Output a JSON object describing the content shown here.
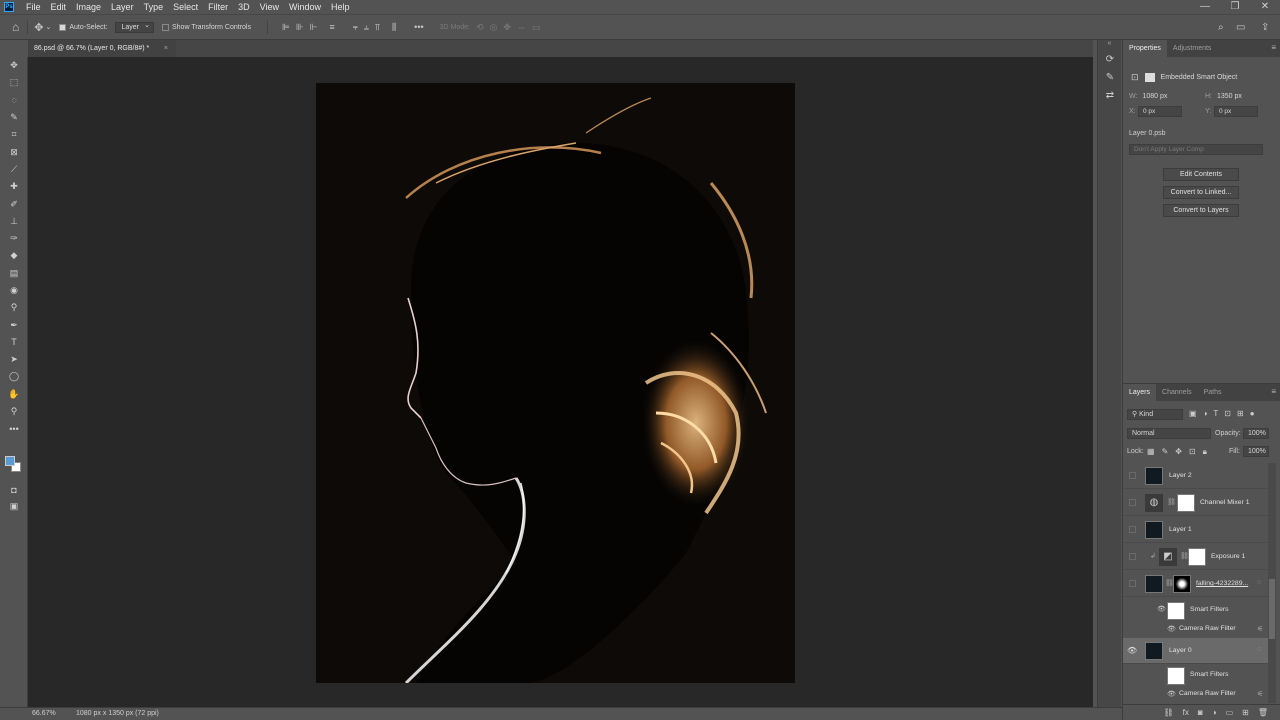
{
  "menu": {
    "logo": "Ps",
    "items": [
      "File",
      "Edit",
      "Image",
      "Layer",
      "Type",
      "Select",
      "Filter",
      "3D",
      "View",
      "Window",
      "Help"
    ],
    "controls": {
      "minimize": "—",
      "restore": "❐",
      "close": "✕"
    }
  },
  "options_bar": {
    "auto_select_label": "Auto-Select:",
    "auto_select_checked": true,
    "target_value": "Layer",
    "show_transform_label": "Show Transform Controls",
    "show_transform_checked": false,
    "mode_3d_label": "3D Mode:"
  },
  "document": {
    "tab_title": "86.psd @ 66.7% (Layer 0, RGB/8#) *",
    "close_glyph": "×"
  },
  "tools": [
    "move-tool",
    "marquee-tool",
    "lasso-tool",
    "quick-select-tool",
    "crop-tool",
    "frame-tool",
    "eyedropper-tool",
    "healing-tool",
    "brush-tool",
    "stamp-tool",
    "history-brush-tool",
    "eraser-tool",
    "gradient-tool",
    "blur-tool",
    "dodge-tool",
    "pen-tool",
    "type-tool",
    "path-select-tool",
    "shape-tool",
    "hand-tool",
    "zoom-tool",
    "more-tools"
  ],
  "colors": {
    "foreground": "#5b9bd5",
    "background": "#ffffff",
    "accent_blue": "#31a8ff"
  },
  "status": {
    "zoom": "66.67%",
    "doc_info": "1080 px x 1350 px (72 ppi)"
  },
  "properties": {
    "tabs": [
      "Properties",
      "Adjustments"
    ],
    "active_tab": "Properties",
    "kind": "Embedded Smart Object",
    "w_label": "W:",
    "w_value": "1080 px",
    "h_label": "H:",
    "h_value": "1350 px",
    "x_label": "X:",
    "x_value": "0 px",
    "y_label": "Y:",
    "y_value": "0 px",
    "source_file": "Layer 0.psb",
    "layer_comp_placeholder": "Don't Apply Layer Comp",
    "buttons": [
      "Edit Contents",
      "Convert to Linked...",
      "Convert to Layers"
    ]
  },
  "layers": {
    "tabs": [
      "Layers",
      "Channels",
      "Paths"
    ],
    "active_tab": "Layers",
    "filter_kind": "Kind",
    "blend_mode": "Normal",
    "opacity_label": "Opacity:",
    "opacity_value": "100%",
    "lock_label": "Lock:",
    "fill_label": "Fill:",
    "fill_value": "100%",
    "rows": [
      {
        "name": "Layer 2",
        "type": "image"
      },
      {
        "name": "Channel Mixer 1",
        "type": "adjustment"
      },
      {
        "name": "Layer 1",
        "type": "image"
      },
      {
        "name": "Exposure 1",
        "type": "adjustment"
      },
      {
        "name": "falling-4232289...",
        "type": "smart-masked"
      },
      {
        "name": "Smart Filters",
        "type": "smart-filters"
      },
      {
        "name": "Camera Raw Filter",
        "type": "filter"
      },
      {
        "name": "Layer 0",
        "type": "smart",
        "selected": true
      },
      {
        "name": "Smart Filters",
        "type": "smart-filters"
      },
      {
        "name": "Camera Raw Filter",
        "type": "filter"
      }
    ]
  }
}
